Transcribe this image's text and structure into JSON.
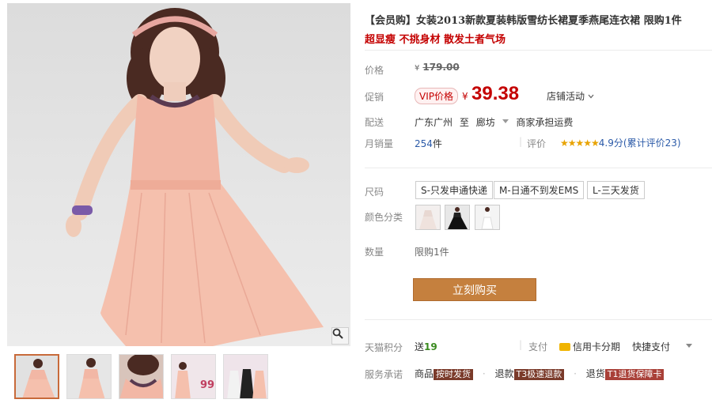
{
  "product": {
    "title": "【会员购】女装2013新款夏装韩版雪纺长裙夏季燕尾连衣裙 限购1件",
    "subtitle": "超显瘦 不挑身材 散发土者气场"
  },
  "price": {
    "label": "价格",
    "currency": "¥",
    "original": "179.00"
  },
  "promo": {
    "label": "促销",
    "badge": "VIP价格",
    "currency": "¥",
    "price": "39.38",
    "store_activity": "店铺活动",
    "dropdown_icon": "chevron-down"
  },
  "shipping": {
    "label": "配送",
    "from": "广东广州",
    "to_word": "至",
    "to": "廊坊",
    "fee": "商家承担运费"
  },
  "sales": {
    "label": "月销量",
    "count": "254",
    "unit": "件",
    "rating_label": "评价",
    "stars": "★★★★★",
    "rating_text": "4.9分(累计评价23)"
  },
  "size": {
    "label": "尺码",
    "options": [
      "S-只发申通快递",
      "M-日通不到发EMS",
      "L-三天发货"
    ]
  },
  "color": {
    "label": "颜色分类",
    "swatches": 3
  },
  "quantity": {
    "label": "数量",
    "text": "限购1件"
  },
  "buy_button": "立刻购买",
  "points": {
    "label": "天猫积分",
    "prefix": "送",
    "value": "19",
    "pay_label": "支付",
    "credit": "信用卡分期",
    "quick": "快捷支付"
  },
  "service": {
    "label": "服务承诺",
    "goods": "商品",
    "goods_tag": "按时发货",
    "refund": "退款",
    "refund_tag": "T3极速退款",
    "return": "退货",
    "return_tag": "T1退货保障卡"
  },
  "thumbnails": {
    "count": 5,
    "promo_text": "99"
  },
  "colors": {
    "accent": "#c40000",
    "buy_button": "#c5803e",
    "link": "#2b5aa8",
    "star": "#e8a300"
  }
}
